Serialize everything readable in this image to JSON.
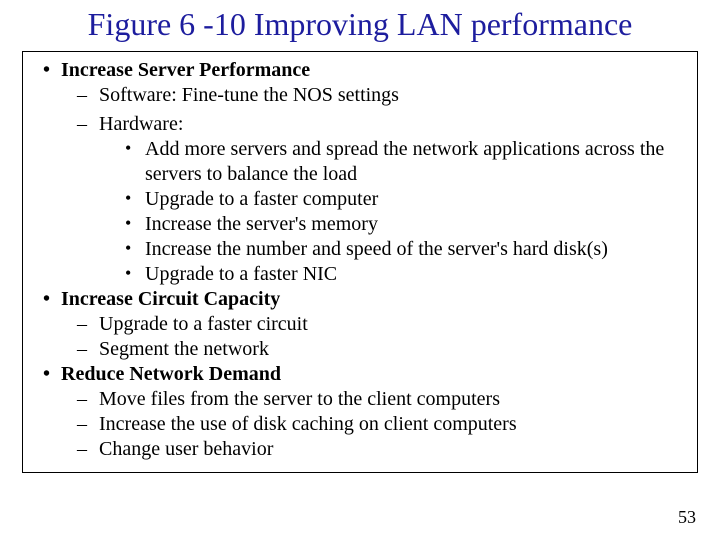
{
  "title": "Figure 6 -10 Improving LAN performance",
  "page_number": "53",
  "bullets": {
    "b1": "Increase Server Performance",
    "b1_1": "Software: Fine-tune the NOS settings",
    "b1_2": "Hardware:",
    "b1_2_1": "Add more servers and spread the network applications across the servers to balance the load",
    "b1_2_2": "Upgrade to a faster computer",
    "b1_2_3": "Increase the server's memory",
    "b1_2_4": "Increase the number and speed of the server's hard disk(s)",
    "b1_2_5": "Upgrade to a faster NIC",
    "b2": "Increase Circuit Capacity",
    "b2_1": "Upgrade to a faster circuit",
    "b2_2": "Segment the network",
    "b3": "Reduce Network Demand",
    "b3_1": "Move files from the server to the client computers",
    "b3_2": "Increase the use of disk caching on client computers",
    "b3_3": "Change user behavior"
  }
}
